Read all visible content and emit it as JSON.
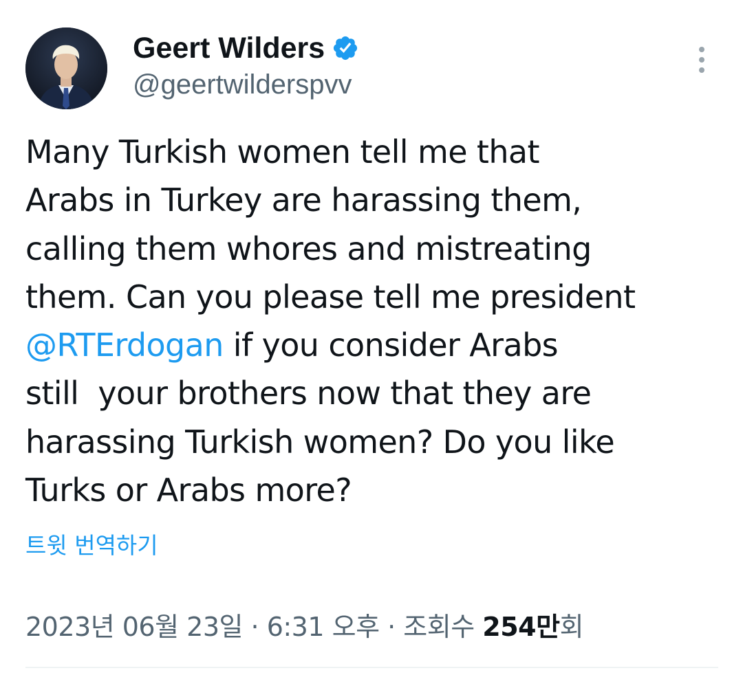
{
  "author": {
    "display_name": "Geert Wilders",
    "handle": "@geertwilderspvv",
    "verified": true,
    "avatar_icon": "profile-photo"
  },
  "tweet": {
    "lines": [
      {
        "segments": [
          {
            "text": "Many Turkish women tell me that",
            "type": "text"
          }
        ]
      },
      {
        "segments": [
          {
            "text": "Arabs in Turkey are harassing them,",
            "type": "text"
          }
        ]
      },
      {
        "segments": [
          {
            "text": "calling them whores and mistreating",
            "type": "text"
          }
        ]
      },
      {
        "segments": [
          {
            "text": "them. Can you please tell me president",
            "type": "text"
          }
        ]
      },
      {
        "segments": [
          {
            "text": "@RTErdogan",
            "type": "mention"
          },
          {
            "text": " if you consider Arabs",
            "type": "text"
          }
        ]
      },
      {
        "segments": [
          {
            "text": "still  your brothers now that they are",
            "type": "text"
          }
        ]
      },
      {
        "segments": [
          {
            "text": "harassing Turkish women? Do you like",
            "type": "text"
          }
        ]
      },
      {
        "segments": [
          {
            "text": "Turks or Arabs more?",
            "type": "text"
          }
        ]
      }
    ],
    "translate_label": "트윗 번역하기"
  },
  "meta": {
    "date": "2023년 06월 23일",
    "separator": " · ",
    "time": "6:31 오후",
    "views_label": "조회수",
    "views_count": "254만",
    "views_suffix": "회"
  },
  "colors": {
    "link": "#1d9bf0",
    "verified": "#1d9bf0",
    "secondary_text": "#536471",
    "primary_text": "#0f1419"
  },
  "icons": {
    "verified": "verified-badge-icon",
    "more": "more-vertical-icon"
  }
}
